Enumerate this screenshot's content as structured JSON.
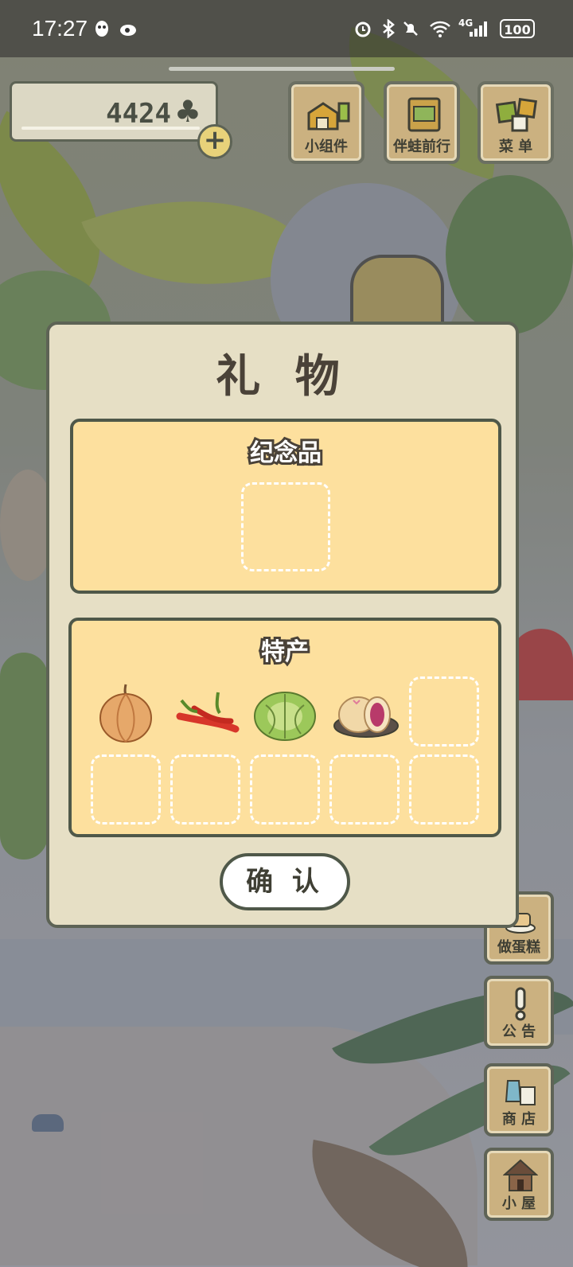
{
  "status_bar": {
    "time": "17:27",
    "battery": "100",
    "network": "4G"
  },
  "hud": {
    "clover_count": "4424",
    "clover_icon": "♣"
  },
  "top_buttons": [
    {
      "label": "小组件",
      "icon": "widget-icon"
    },
    {
      "label": "伴蛙前行",
      "icon": "journey-icon"
    },
    {
      "label": "菜 单",
      "icon": "menu-icon"
    }
  ],
  "side_buttons": [
    {
      "label": "做蛋糕",
      "icon": "cake-icon"
    },
    {
      "label": "公 告",
      "icon": "exclamation-icon"
    },
    {
      "label": "商 店",
      "icon": "shop-bag-icon"
    },
    {
      "label": "小 屋",
      "icon": "house-icon"
    }
  ],
  "dialog": {
    "title": "礼 物",
    "souvenir": {
      "title": "纪念品"
    },
    "specialty": {
      "title": "特产",
      "items": [
        "onion",
        "chili-peppers",
        "cabbage",
        "mooncake"
      ]
    },
    "confirm_label": "确 认"
  }
}
